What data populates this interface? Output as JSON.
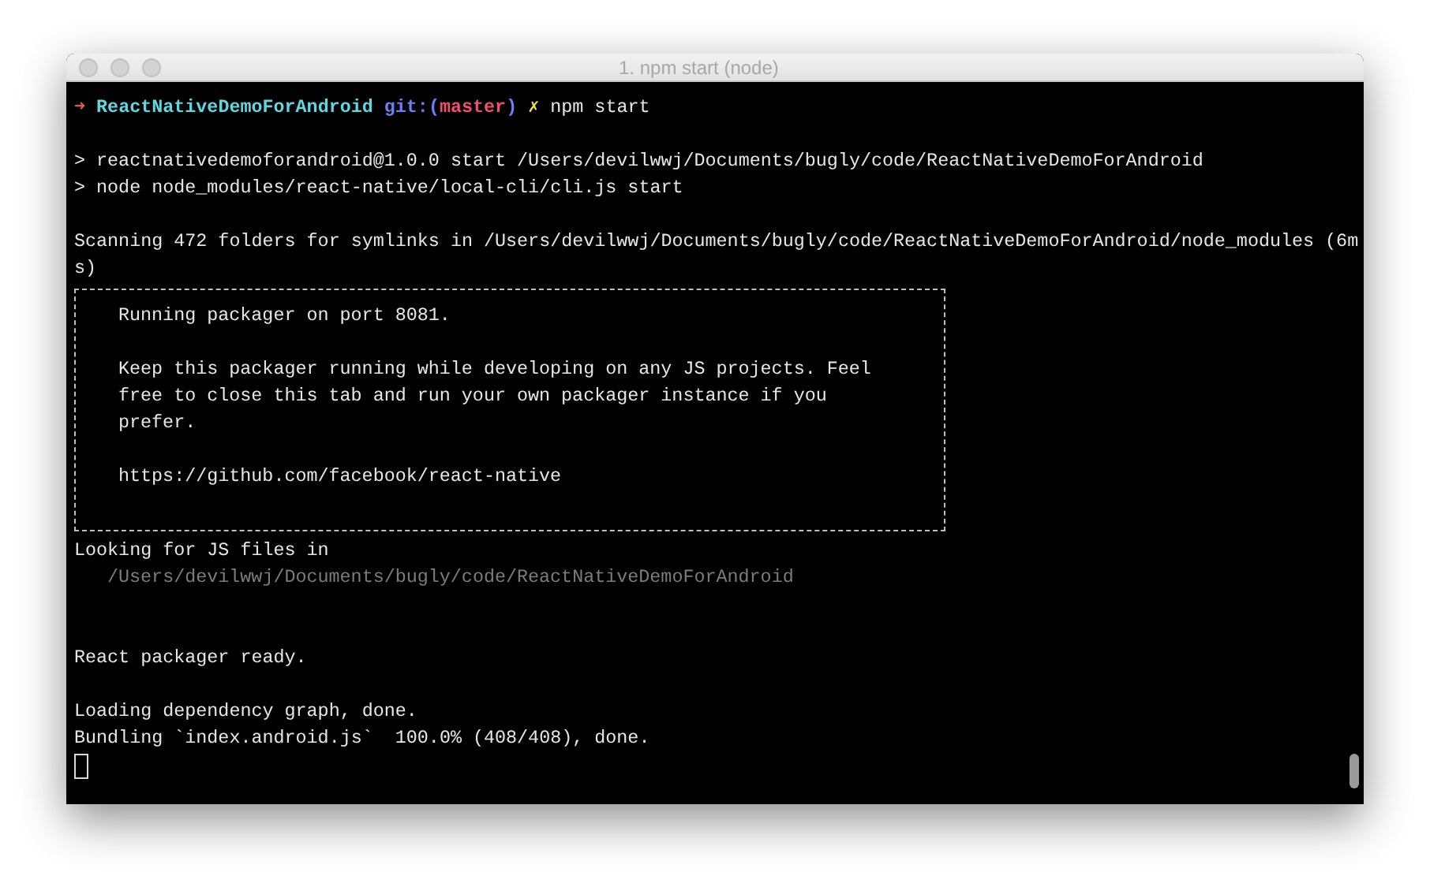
{
  "window": {
    "title": "1. npm start (node)"
  },
  "prompt": {
    "arrow": "➜",
    "directory": "ReactNativeDemoForAndroid",
    "git_label": "git:(",
    "branch": "master",
    "git_close": ")",
    "dirty_mark": "✗",
    "command": "npm start"
  },
  "output": [
    {
      "kind": "blank"
    },
    {
      "kind": "text",
      "text": "> reactnativedemoforandroid@1.0.0 start /Users/devilwwj/Documents/bugly/code/ReactNativeDemoForAndroid"
    },
    {
      "kind": "text",
      "text": "> node node_modules/react-native/local-cli/cli.js start"
    },
    {
      "kind": "blank"
    },
    {
      "kind": "text",
      "text": "Scanning 472 folders for symlinks in /Users/devilwwj/Documents/bugly/code/ReactNativeDemoForAndroid/node_modules (6m"
    },
    {
      "kind": "text",
      "text": "s)"
    },
    {
      "kind": "box",
      "lines": [
        {
          "kind": "text",
          "text": "Running packager on port 8081."
        },
        {
          "kind": "blank"
        },
        {
          "kind": "text",
          "text": "Keep this packager running while developing on any JS projects. Feel"
        },
        {
          "kind": "text",
          "text": "free to close this tab and run your own packager instance if you"
        },
        {
          "kind": "text",
          "text": "prefer."
        },
        {
          "kind": "blank"
        },
        {
          "kind": "text",
          "text": "https://github.com/facebook/react-native"
        },
        {
          "kind": "blank"
        }
      ]
    },
    {
      "kind": "text",
      "text": "Looking for JS files in"
    },
    {
      "kind": "dim",
      "text": "/Users/devilwwj/Documents/bugly/code/ReactNativeDemoForAndroid"
    },
    {
      "kind": "blank"
    },
    {
      "kind": "blank"
    },
    {
      "kind": "text",
      "text": "React packager ready."
    },
    {
      "kind": "blank"
    },
    {
      "kind": "text",
      "text": "Loading dependency graph, done."
    },
    {
      "kind": "text",
      "text": "Bundling `index.android.js`  100.0% (408/408), done."
    },
    {
      "kind": "cursor"
    }
  ]
}
